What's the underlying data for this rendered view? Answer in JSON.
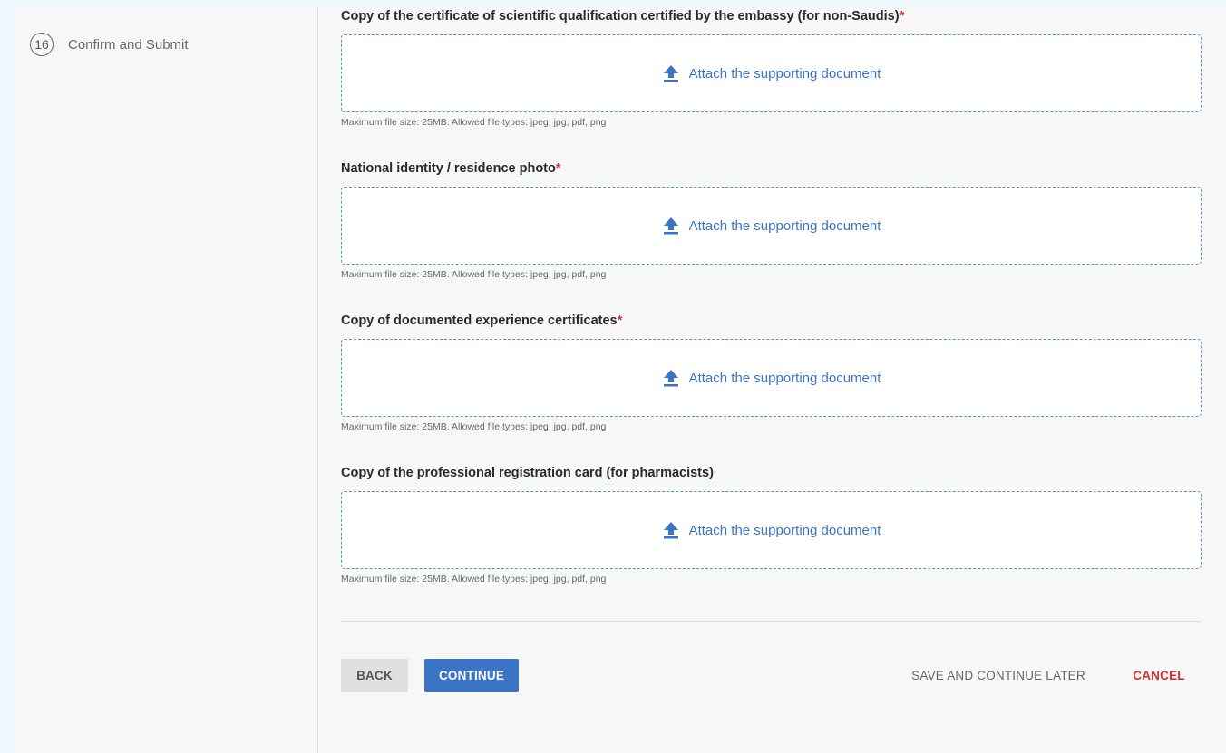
{
  "sidebar": {
    "step": {
      "number": "16",
      "label": "Confirm and Submit"
    }
  },
  "fields": [
    {
      "label": "Copy of the certificate of scientific qualification certified by the embassy (for non-Saudis)",
      "required": "*",
      "attach_text": "Attach the supporting document",
      "hint": "Maximum file size: 25MB. Allowed file types: jpeg, jpg, pdf, png"
    },
    {
      "label": "National identity / residence photo",
      "required": "*",
      "attach_text": "Attach the supporting document",
      "hint": "Maximum file size: 25MB. Allowed file types: jpeg, jpg, pdf, png"
    },
    {
      "label": "Copy of documented experience certificates",
      "required": "*",
      "attach_text": "Attach the supporting document",
      "hint": "Maximum file size: 25MB. Allowed file types: jpeg, jpg, pdf, png"
    },
    {
      "label": "Copy of the professional registration card (for pharmacists)",
      "required": "",
      "attach_text": "Attach the supporting document",
      "hint": "Maximum file size: 25MB. Allowed file types: jpeg, jpg, pdf, png"
    }
  ],
  "actions": {
    "back": "BACK",
    "continue": "CONTINUE",
    "save_later": "SAVE AND CONTINUE LATER",
    "cancel": "CANCEL"
  },
  "colors": {
    "accent": "#3b74c4",
    "danger": "#d32f2f",
    "page_bg": "#f1f8fd"
  },
  "icons": {
    "upload": "upload-arrow-icon"
  }
}
